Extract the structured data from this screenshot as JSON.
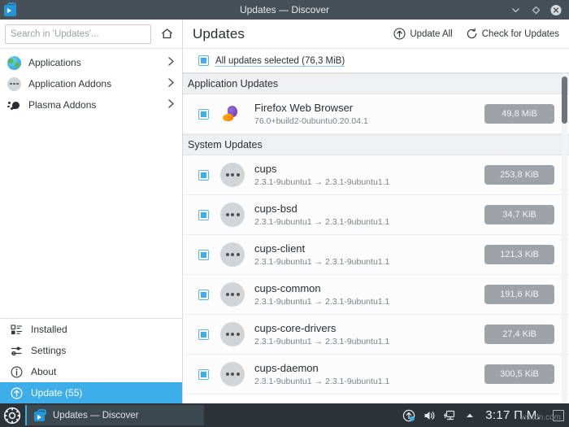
{
  "window": {
    "title": "Updates — Discover",
    "app_icon": "discover-bag-icon",
    "buttons": [
      {
        "name": "minimize",
        "glyph": "chevron-down"
      },
      {
        "name": "maximize",
        "glyph": "diamond"
      },
      {
        "name": "close",
        "glyph": "x-circle"
      }
    ]
  },
  "sidebar": {
    "search": {
      "placeholder": "Search in 'Updates'...",
      "value": ""
    },
    "home_icon": "home-icon",
    "items": [
      {
        "label": "Applications",
        "icon": "globe-icon",
        "chevron": "›"
      },
      {
        "label": "Application Addons",
        "icon": "dots-circle-icon",
        "chevron": "›"
      },
      {
        "label": "Plasma Addons",
        "icon": "plasma-icon",
        "chevron": "›"
      }
    ],
    "bottom_items": [
      {
        "label": "Installed",
        "icon": "list-icon",
        "active": false
      },
      {
        "label": "Settings",
        "icon": "sliders-icon",
        "active": false
      },
      {
        "label": "About",
        "icon": "info-icon",
        "active": false
      },
      {
        "label": "Update (55)",
        "icon": "update-arrow-icon",
        "active": true
      }
    ]
  },
  "main": {
    "page_title": "Updates",
    "actions": [
      {
        "label": "Update All",
        "icon": "up-arrow-circle-icon"
      },
      {
        "label": "Check for Updates",
        "icon": "refresh-icon"
      }
    ],
    "select_all": {
      "label": "All updates selected (76,3 MiB)",
      "checked": true
    },
    "sections": [
      {
        "heading": "Application Updates",
        "rows": [
          {
            "name": "Firefox Web Browser",
            "version": "76.0+build2-0ubuntu0.20.04.1",
            "size": "49,8 MiB",
            "icon": "firefox-icon",
            "checked": true
          }
        ]
      },
      {
        "heading": "System Updates",
        "rows": [
          {
            "name": "cups",
            "version": "2.3.1-9ubuntu1 → 2.3.1-9ubuntu1.1",
            "size": "253,8 KiB",
            "icon": "package-icon",
            "checked": true
          },
          {
            "name": "cups-bsd",
            "version": "2.3.1-9ubuntu1 → 2.3.1-9ubuntu1.1",
            "size": "34,7 KiB",
            "icon": "package-icon",
            "checked": true
          },
          {
            "name": "cups-client",
            "version": "2.3.1-9ubuntu1 → 2.3.1-9ubuntu1.1",
            "size": "121,3 KiB",
            "icon": "package-icon",
            "checked": true
          },
          {
            "name": "cups-common",
            "version": "2.3.1-9ubuntu1 → 2.3.1-9ubuntu1.1",
            "size": "191,6 KiB",
            "icon": "package-icon",
            "checked": true
          },
          {
            "name": "cups-core-drivers",
            "version": "2.3.1-9ubuntu1 → 2.3.1-9ubuntu1.1",
            "size": "27,4 KiB",
            "icon": "package-icon",
            "checked": true
          },
          {
            "name": "cups-daemon",
            "version": "2.3.1-9ubuntu1 → 2.3.1-9ubuntu1.1",
            "size": "300,5 KiB",
            "icon": "package-icon",
            "checked": true
          }
        ]
      }
    ]
  },
  "taskbar": {
    "launcher_icon": "kde-gear-icon",
    "task": {
      "label": "Updates — Discover",
      "icon": "discover-bag-icon"
    },
    "tray": [
      {
        "name": "updates-tray-icon"
      },
      {
        "name": "volume-icon"
      },
      {
        "name": "network-icon"
      },
      {
        "name": "show-hidden-arrow-icon"
      }
    ],
    "clock": "3:17 Π.Μ.",
    "show_desktop_icon": "show-desktop-icon"
  },
  "watermark": "wsxdn.com",
  "colors": {
    "accent": "#3daee9",
    "titlebar": "#475057",
    "taskbar": "#2b3339",
    "section_header": "#eff0f1",
    "badge": "#9ea3a7"
  }
}
